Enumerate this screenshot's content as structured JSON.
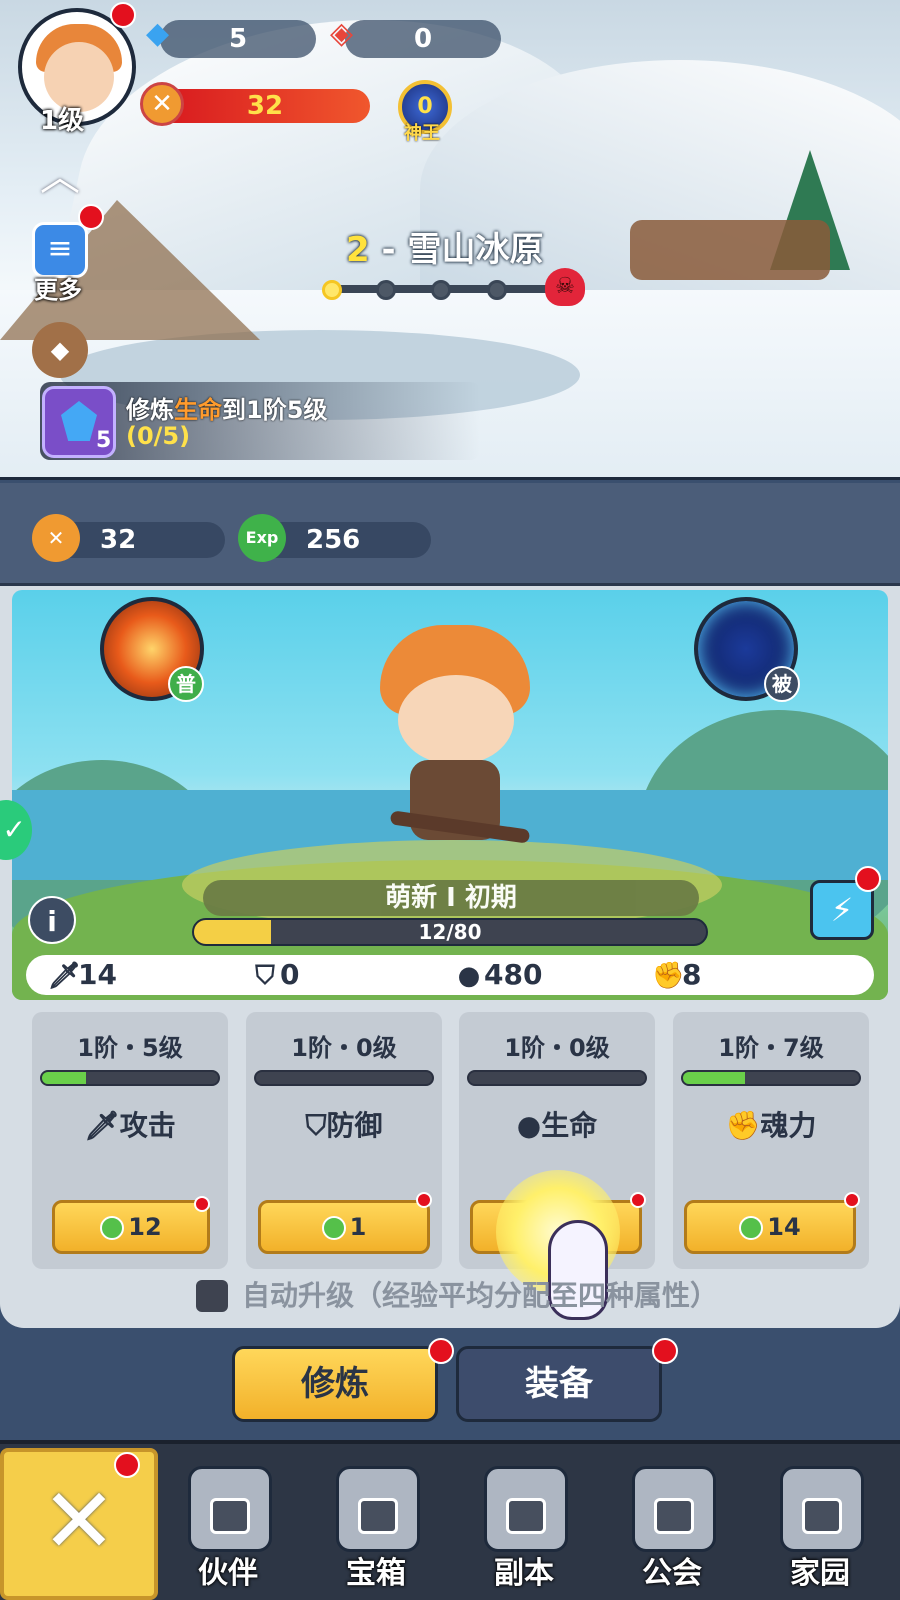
{
  "player": {
    "level_label": "1级"
  },
  "resources": {
    "gems": "5",
    "tickets": "0"
  },
  "power": {
    "value": "32"
  },
  "god_rank": {
    "value": "0",
    "label": "神王"
  },
  "side_menu": {
    "more_label": "更多"
  },
  "stage": {
    "number": "2",
    "separator": " - ",
    "name": "雪山冰原",
    "progress_nodes": 5,
    "current_node": 1
  },
  "quest": {
    "icon_count": "5",
    "text_prefix": "修炼",
    "text_highlight": "生命",
    "text_suffix": "到1阶5级",
    "progress": "(0/5)"
  },
  "stats_strip": {
    "attack": "32",
    "exp": "256",
    "exp_icon_text": "Exp"
  },
  "skills": {
    "normal_tag": "普",
    "passive_tag": "被"
  },
  "rank": {
    "title": "萌新 I  初期",
    "xp_text": "12/80",
    "xp_fraction": 0.15
  },
  "attributes": [
    {
      "icon": "sword-icon",
      "value": "14"
    },
    {
      "icon": "shield-icon",
      "value": "0"
    },
    {
      "icon": "drop-icon",
      "value": "480"
    },
    {
      "icon": "fist-icon",
      "value": "8"
    }
  ],
  "cards": [
    {
      "level": "1阶・5级",
      "name": "攻击",
      "icon": "sword-icon",
      "progress": 0.25,
      "cost": "12",
      "has_dot": true
    },
    {
      "level": "1阶・0级",
      "name": "防御",
      "icon": "shield-icon",
      "progress": 0,
      "cost": "1",
      "has_dot": true
    },
    {
      "level": "1阶・0级",
      "name": "生命",
      "icon": "drop-icon",
      "progress": 0,
      "cost": "1",
      "has_dot": true
    },
    {
      "level": "1阶・7级",
      "name": "魂力",
      "icon": "fist-icon",
      "progress": 0.35,
      "cost": "14",
      "has_dot": true
    }
  ],
  "auto_upgrade": {
    "label": "自动升级（经验平均分配至四种属性）",
    "checked": false
  },
  "main_tabs": {
    "train": "修炼",
    "equip": "装备"
  },
  "bottom_nav": [
    {
      "label": "伙伴",
      "locked": true
    },
    {
      "label": "宝箱",
      "locked": true
    },
    {
      "label": "副本",
      "locked": true
    },
    {
      "label": "公会",
      "locked": true
    },
    {
      "label": "家园",
      "locked": true
    }
  ],
  "colors": {
    "accent_yellow": "#f4cf45",
    "exp_green": "#55c04a",
    "notify_red": "#e3101e",
    "panel_bg": "#d6dde4"
  }
}
